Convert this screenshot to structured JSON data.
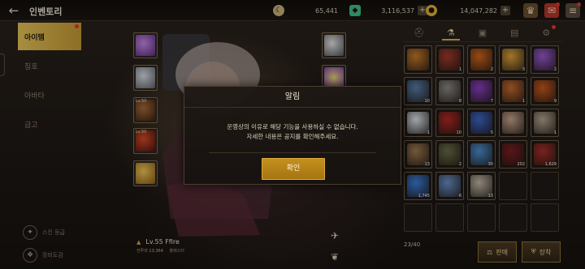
{
  "topbar": {
    "title": "인벤토리",
    "back_icon": "arrow-left-icon",
    "home_icon": "home-icon",
    "currencies": [
      {
        "name": "moon-coin",
        "value": "65,441",
        "color": "#c9b27a"
      },
      {
        "name": "green-crystal",
        "value": "3,116,537",
        "color": "#3fbf8a"
      },
      {
        "name": "gold-coin",
        "value": "14,047,282",
        "color": "#e2b23a"
      }
    ],
    "icons": [
      "treasure-icon",
      "mail-icon",
      "menu-icon"
    ]
  },
  "left_menu": {
    "items": [
      {
        "label": "아이템",
        "active": true
      },
      {
        "label": "칭호",
        "active": false
      },
      {
        "label": "아바타",
        "active": false
      },
      {
        "label": "금고",
        "active": false
      }
    ],
    "bottom": [
      {
        "label": "스킨 등급"
      },
      {
        "label": "장비도감"
      }
    ]
  },
  "equipment": {
    "left_slots": [
      {
        "level": "",
        "color": "#8a3bbf"
      },
      {
        "level": "",
        "color": "#9aa0a8"
      },
      {
        "level": "Lv.50",
        "color": "#6b3b24"
      },
      {
        "level": "Lv.50",
        "color": "#9b2a1e"
      },
      {
        "level": "",
        "color": "#d9a238"
      }
    ],
    "right_slots": [
      {
        "level": "",
        "color": "#bfbfbf"
      },
      {
        "level": "",
        "color": "#d1b84a"
      }
    ]
  },
  "character": {
    "level_name": "Lv.55 Ffire",
    "power_label": "전투력",
    "power_value": "13,364",
    "extra": "플래스터"
  },
  "inventory": {
    "tabs": [
      "helmet-icon",
      "potion-icon",
      "chest-icon",
      "card-icon",
      "gear-icon"
    ],
    "active_tab": 1,
    "items": [
      {
        "color": "#c97a2a",
        "qty": ""
      },
      {
        "color": "#a33b2c",
        "qty": "1"
      },
      {
        "color": "#d2661c",
        "qty": "2"
      },
      {
        "color": "#e0a23c",
        "qty": "3"
      },
      {
        "color": "#9b5bd1",
        "qty": "2"
      },
      {
        "color": "#5a7ea8",
        "qty": "10"
      },
      {
        "color": "#8c8a86",
        "qty": "8"
      },
      {
        "color": "#8a3fbf",
        "qty": "7"
      },
      {
        "color": "#c76a2f",
        "qty": "1"
      },
      {
        "color": "#c85a1c",
        "qty": "9"
      },
      {
        "color": "#dfe6ee",
        "qty": "1"
      },
      {
        "color": "#b22a22",
        "qty": "10"
      },
      {
        "color": "#3f66c8",
        "qty": "5"
      },
      {
        "color": "#c9a58c",
        "qty": ""
      },
      {
        "color": "#b6a590",
        "qty": "1"
      },
      {
        "color": "#a07a52",
        "qty": "13"
      },
      {
        "color": "#6b6e48",
        "qty": "2"
      },
      {
        "color": "#4f8fd0",
        "qty": "30"
      },
      {
        "color": "#7a1f22",
        "qty": "202"
      },
      {
        "color": "#a6302a",
        "qty": "1,629"
      },
      {
        "color": "#3d7ed8",
        "qty": "1,745"
      },
      {
        "color": "#6c90c8",
        "qty": "6"
      },
      {
        "color": "#c4b9a6",
        "qty": "13"
      },
      {
        "color": "",
        "qty": ""
      },
      {
        "color": "",
        "qty": ""
      },
      {
        "color": "",
        "qty": ""
      },
      {
        "color": "",
        "qty": ""
      },
      {
        "color": "",
        "qty": ""
      },
      {
        "color": "",
        "qty": ""
      },
      {
        "color": "",
        "qty": ""
      }
    ],
    "count": "23/40",
    "sell_label": "판매",
    "equip_label": "장착"
  },
  "modal": {
    "title": "알림",
    "line1": "운영상의 이유로 해당 기능을 사용하실 수 없습니다.",
    "line2": "자세한 내용은 공지를 확인해주세요.",
    "confirm": "확인"
  }
}
